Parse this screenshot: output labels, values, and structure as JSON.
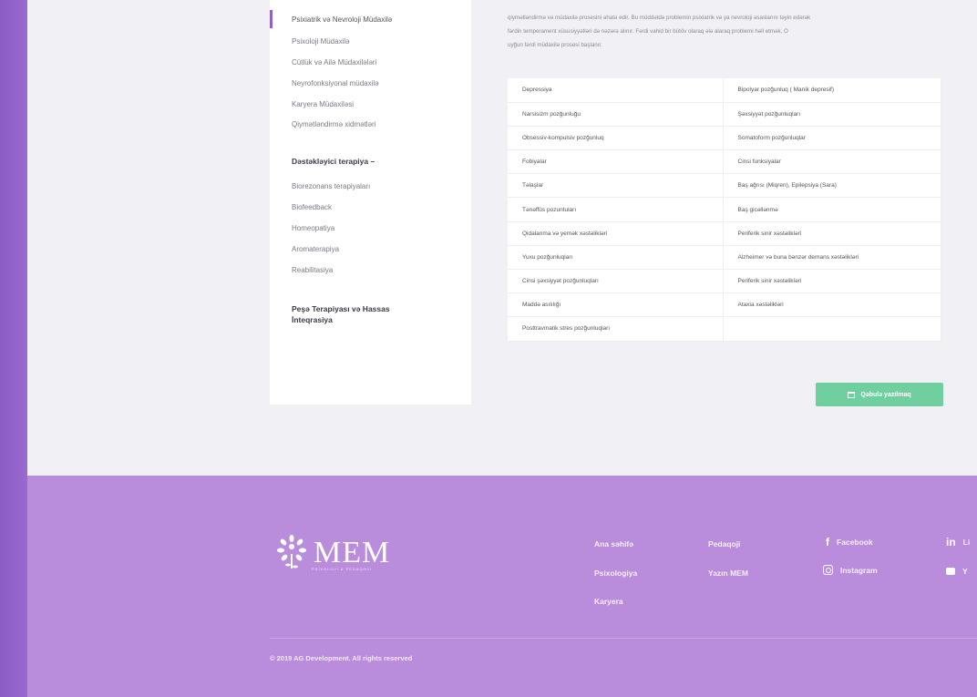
{
  "sidebar": {
    "items": [
      {
        "label": "Psixiatrik və Nevroloji Müdaxilə",
        "active": true
      },
      {
        "label": "Psixoloji Müdaxilə"
      },
      {
        "label": "Cütlük və Ailə Müdaxilələri"
      },
      {
        "label": "Neyrofonksiyonal müdaxilə"
      },
      {
        "label": "Karyera Müdaxiləsi"
      },
      {
        "label": "Qiymətləndirmə xidmətləri"
      }
    ],
    "support_heading": "Dəstəkləyici terapiya",
    "support_items": [
      {
        "label": "Biorezonans terapiyaları"
      },
      {
        "label": "Biofeedback"
      },
      {
        "label": "Homeopatiya"
      },
      {
        "label": "Aromaterapiya"
      },
      {
        "label": "Reabilitasiya"
      }
    ],
    "extra_heading": "Peşə Terapiyası və Hassas İnteqrasiya"
  },
  "intro": {
    "line1": "qiymətləndirmə və müdaxilə prosesini əhatə edir. Bu müddətdə problemin psixiatrik və ya nevroloji əsaslarını təyin edərək",
    "line2": "fərdin temperament xüsusiyyətləri də nəzərə alınır. Fərdi vahid bir bütöv olaraq ələ alaraq problemi həll etmək, O",
    "line3": "uyğun fərdi müdaxilə prosesi başlanır."
  },
  "table": {
    "rows": [
      [
        "Depressiya",
        "Bipolyar pozğunluq ( Manik depresif)"
      ],
      [
        "Narsisizm pozğunluğu",
        "Şəxsiyyət pozğunluqları"
      ],
      [
        "Obsessiv-kompulsiv pozğunluq",
        "Somatoform pozğunluqlar"
      ],
      [
        "Fobiyalar",
        "Cinsi funksiyalar"
      ],
      [
        "Təlaşlar",
        "Baş ağrısı (Miqren), Epilepsiya (Sara)"
      ],
      [
        "Tənəffüs pozuntuları",
        "Baş gicəllənmə"
      ],
      [
        "Qidalanma və yemək xəstəlikləri",
        "Periferik sinir xəstəlikləri"
      ],
      [
        "Yuxu pozğunluqları",
        "Alzheimer və buna bənzər demans xəstəlikləri"
      ],
      [
        "Cinsi şəxsiyyət pozğunluqları",
        "Periferik sinir xəstəlikləri"
      ],
      [
        "Maddə asılılığı",
        "Ataxia xəstəlikləri"
      ],
      [
        "Posttravmatik stres pozğunluqları",
        ""
      ]
    ]
  },
  "appointment_button": {
    "label": "Qəbulə yazılmaq",
    "icon": "calendar-icon",
    "color": "#6fcf9e"
  },
  "footer": {
    "brand": "MEM",
    "brand_sub": "PSİXOLOJİ & PEDAQOJİ",
    "nav": {
      "home": "Ana səhifə",
      "psychology": "Psixologiya",
      "career": "Karyera",
      "pedagogy": "Pedaqoji",
      "tarix": "Yazın MEM"
    },
    "social": {
      "facebook": "Facebook",
      "instagram": "Instagram",
      "linkedin": "Li",
      "youtube": "Y"
    },
    "copyright": "© 2019 AG Development. All rights reserved",
    "color": "#b98ddc"
  },
  "accent": "#8f5fd0"
}
